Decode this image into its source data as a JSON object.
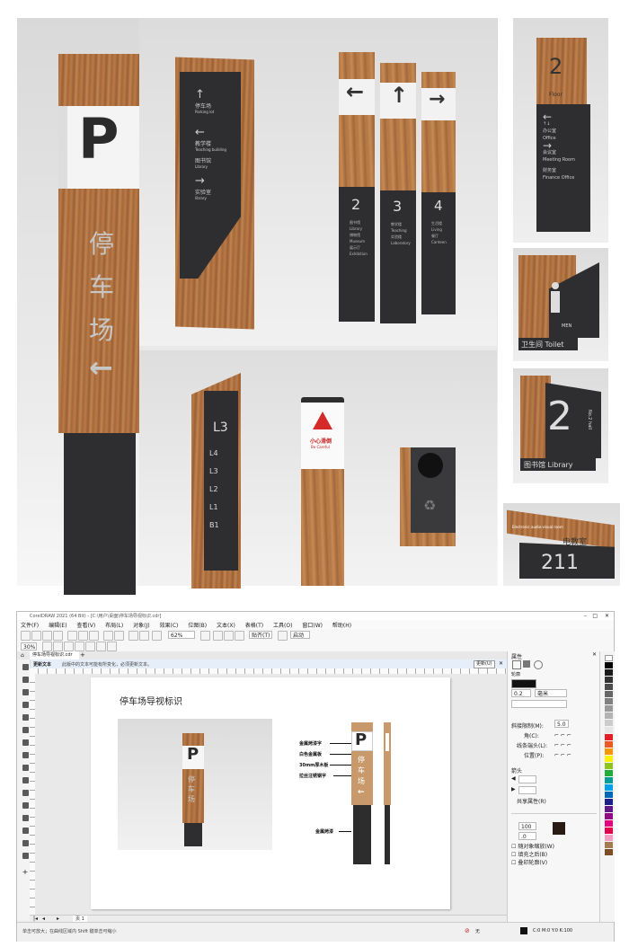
{
  "gallery": {
    "parking_sign": {
      "letter": "P",
      "chars": [
        "停",
        "车",
        "场"
      ],
      "arrow": "←"
    },
    "directory_sign": {
      "items": [
        {
          "arrow": "↑",
          "cn": "停车场",
          "en": "Parking lot"
        },
        {
          "arrow": "←",
          "cn": "教学楼",
          "en": "Teaching building"
        },
        {
          "arrow": "",
          "cn": "图书馆",
          "en": "Library"
        },
        {
          "arrow": "→",
          "cn": "实验室",
          "en": "library"
        }
      ]
    },
    "triple_posts": [
      {
        "arrow": "←",
        "number": "2",
        "lines": [
          "图书馆",
          "Library",
          "博物馆",
          "Museum",
          "展示厅",
          "Exhibition"
        ]
      },
      {
        "arrow": "↑",
        "number": "3",
        "lines": [
          "教学楼",
          "Teaching",
          "实验楼",
          "Laboratory"
        ]
      },
      {
        "arrow": "→",
        "number": "4",
        "lines": [
          "生活楼",
          "Living",
          "餐厅",
          "Canteen"
        ]
      }
    ],
    "floor_sign": {
      "number": "2",
      "label": "Floor",
      "rows": [
        {
          "arrow": "←",
          "icon": "↑↓",
          "cn": "办公室",
          "en": "Office"
        },
        {
          "arrow": "→",
          "cn": "会议室",
          "en": "Meeting Room"
        },
        {
          "arrow": "",
          "cn": "财务室",
          "en": "Finance Office"
        }
      ]
    },
    "toilet_sign": {
      "en": "MEN",
      "caption": "卫生间 Toilet"
    },
    "hall_sign": {
      "number": "2",
      "side": "No.2 hall",
      "caption": "图书馆 Library"
    },
    "level_sign": {
      "title": "L3",
      "rows": [
        "L4",
        "L3",
        "L2",
        "L1",
        "B1"
      ]
    },
    "caution_sign": {
      "cn": "小心滑倒",
      "en": "Be Careful"
    },
    "room_sign": {
      "cn": "电教室",
      "en": "Electronic audio-visual room",
      "number": "211"
    }
  },
  "app": {
    "title": "CorelDRAW 2021 (64 Bit) - [C:\\用户\\桌面\\停车场导视标识.cdr]",
    "menu": [
      "文件(F)",
      "编辑(E)",
      "查看(V)",
      "布局(L)",
      "对象(J)",
      "效果(C)",
      "位图(B)",
      "文本(X)",
      "表格(T)",
      "工具(O)",
      "窗口(W)",
      "帮助(H)"
    ],
    "toolbar": {
      "zoom": "62%",
      "snap": "贴齐(T)",
      "launch": "启动"
    },
    "prop_bar": {
      "zoom": "30%"
    },
    "doc_tab": "停车场导视标识.cdr",
    "notice": {
      "title": "更新文本",
      "text": "此版中的文本可能有所变化，必须更新文本。",
      "button": "更新(U)"
    },
    "canvas": {
      "title": "停车场导视标识",
      "annotations": [
        "金属烤漆字",
        "白色金属板",
        "30mm厚木板",
        "拉丝注锈钢字",
        "金属烤漆"
      ],
      "drawing": {
        "letter": "P",
        "chars": [
          "停",
          "车",
          "场"
        ],
        "arrow": "←"
      }
    },
    "properties": {
      "title": "属性",
      "outline_label": "轮廓",
      "width_value": "0.2 mm",
      "unit": "毫米",
      "corner_label": "斜接限制(M):",
      "corner_value": "5.0",
      "miter_label": "角(C):",
      "line_label": "线条端头(L):",
      "position_label": "位置(P):",
      "arrow_label": "箭头",
      "share_label": "共享属性(R)",
      "value_100": "100",
      "value_00": ".0",
      "check1": "随对象缩放(W)",
      "check2": "填充之后(B)",
      "check3": "叠印轮廓(V)"
    },
    "status": {
      "left": "单击可放大；在曲线区域内 Shift 键单击可缩小",
      "fill": "无",
      "color_info": "C:0 M:0 Y:0 K:100"
    },
    "page_tab": "页 1"
  }
}
